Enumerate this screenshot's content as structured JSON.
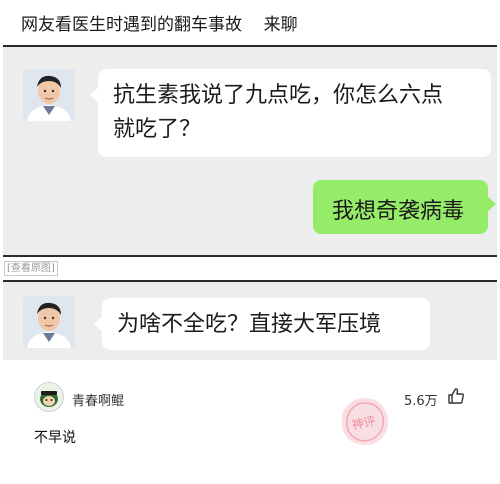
{
  "post": {
    "title": "网友看医生时遇到的翻车事故",
    "category": "来聊"
  },
  "chat1": {
    "doctor_message_line1": "抗生素我说了九点吃，你怎么六点",
    "doctor_message_line2": "就吃了？",
    "patient_reply": "我想奇袭病毒"
  },
  "view_original_label": "[查看原图]",
  "chat2": {
    "doctor_message": "为啥不全吃？直接大军压境"
  },
  "comment": {
    "username": "青春啊鲲",
    "likes": "5.6万",
    "text": "不早说",
    "stamp_text": "神评"
  },
  "colors": {
    "chat_background": "#ededed",
    "incoming_bubble": "#ffffff",
    "outgoing_bubble": "#95ec69"
  }
}
